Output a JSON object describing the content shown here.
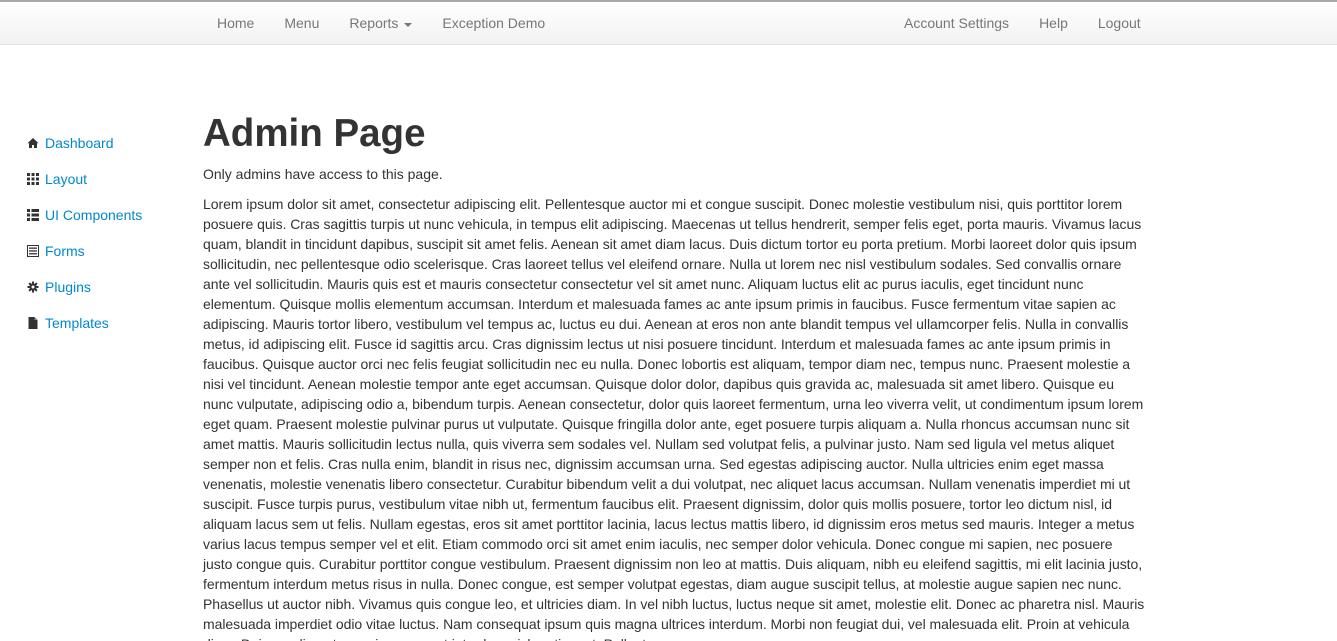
{
  "navbar": {
    "left": [
      {
        "label": "Home"
      },
      {
        "label": "Menu"
      },
      {
        "label": "Reports"
      },
      {
        "label": "Exception Demo"
      }
    ],
    "right": [
      {
        "label": "Account Settings"
      },
      {
        "label": "Help"
      },
      {
        "label": "Logout"
      }
    ]
  },
  "sidebar": {
    "items": [
      {
        "label": "Dashboard",
        "icon": "home-icon"
      },
      {
        "label": "Layout",
        "icon": "th-icon"
      },
      {
        "label": "UI Components",
        "icon": "th-list-icon"
      },
      {
        "label": "Forms",
        "icon": "list-alt-icon"
      },
      {
        "label": "Plugins",
        "icon": "cog-icon"
      },
      {
        "label": "Templates",
        "icon": "file-icon"
      }
    ]
  },
  "main": {
    "title": "Admin Page",
    "subtitle": "Only admins have access to this page.",
    "body": "Lorem ipsum dolor sit amet, consectetur adipiscing elit. Pellentesque auctor mi et congue suscipit. Donec molestie vestibulum nisi, quis porttitor lorem posuere quis. Cras sagittis turpis ut nunc vehicula, in tempus elit adipiscing. Maecenas ut tellus hendrerit, semper felis eget, porta mauris. Vivamus lacus quam, blandit in tincidunt dapibus, suscipit sit amet felis. Aenean sit amet diam lacus. Duis dictum tortor eu porta pretium. Morbi laoreet dolor quis ipsum sollicitudin, nec pellentesque odio scelerisque. Cras laoreet tellus vel eleifend ornare. Nulla ut lorem nec nisl vestibulum sodales. Sed convallis ornare ante vel sollicitudin. Mauris quis est et mauris consectetur consectetur vel sit amet nunc. Aliquam luctus elit ac purus iaculis, eget tincidunt nunc elementum. Quisque mollis elementum accumsan. Interdum et malesuada fames ac ante ipsum primis in faucibus. Fusce fermentum vitae sapien ac adipiscing. Mauris tortor libero, vestibulum vel tempus ac, luctus eu dui. Aenean at eros non ante blandit tempus vel ullamcorper felis. Nulla in convallis metus, id adipiscing elit. Fusce id sagittis arcu. Cras dignissim lectus ut nisi posuere tincidunt. Interdum et malesuada fames ac ante ipsum primis in faucibus. Quisque auctor orci nec felis feugiat sollicitudin nec eu nulla. Donec lobortis est aliquam, tempor diam nec, tempus nunc. Praesent molestie a nisi vel tincidunt. Aenean molestie tempor ante eget accumsan. Quisque dolor dolor, dapibus quis gravida ac, malesuada sit amet libero. Quisque eu nunc vulputate, adipiscing odio a, bibendum turpis. Aenean consectetur, dolor quis laoreet fermentum, urna leo viverra velit, ut condimentum ipsum lorem eget quam. Praesent molestie pulvinar purus ut vulputate. Quisque fringilla dolor ante, eget posuere turpis aliquam a. Nulla rhoncus accumsan nunc sit amet mattis. Mauris sollicitudin lectus nulla, quis viverra sem sodales vel. Nullam sed volutpat felis, a pulvinar justo. Nam sed ligula vel metus aliquet semper non et felis. Cras nulla enim, blandit in risus nec, dignissim accumsan urna. Sed egestas adipiscing auctor. Nulla ultricies enim eget massa venenatis, molestie venenatis libero consectetur. Curabitur bibendum velit a dui volutpat, nec aliquet lacus accumsan. Nullam venenatis imperdiet mi ut suscipit. Fusce turpis purus, vestibulum vitae nibh ut, fermentum faucibus elit. Praesent dignissim, dolor quis mollis posuere, tortor leo dictum nisl, id aliquam lacus sem ut felis. Nullam egestas, eros sit amet porttitor lacinia, lacus lectus mattis libero, id dignissim eros metus sed mauris. Integer a metus varius lacus tempus semper vel et elit. Etiam commodo orci sit amet enim iaculis, nec semper dolor vehicula. Donec congue mi sapien, nec posuere justo congue quis. Curabitur porttitor congue vestibulum. Praesent dignissim non leo at mattis. Duis aliquam, nibh eu eleifend sagittis, mi elit lacinia justo, fermentum interdum metus risus in nulla. Donec congue, est semper volutpat egestas, diam augue suscipit tellus, at molestie augue sapien nec nunc. Phasellus ut auctor nibh. Vivamus quis congue leo, et ultricies diam. In vel nibh luctus, luctus neque sit amet, molestie elit. Donec ac pharetra nisl. Mauris malesuada imperdiet odio vitae luctus. Nam consequat ipsum quis magna ultrices interdum. Morbi non feugiat dui, vel malesuada elit. Proin at vehicula diam. Duis condimentum enim quam, et interdum nisl pretium ut. Pellentesque"
  },
  "colors": {
    "link": "#0088cc",
    "nav_text": "#777777",
    "text": "#333333"
  }
}
